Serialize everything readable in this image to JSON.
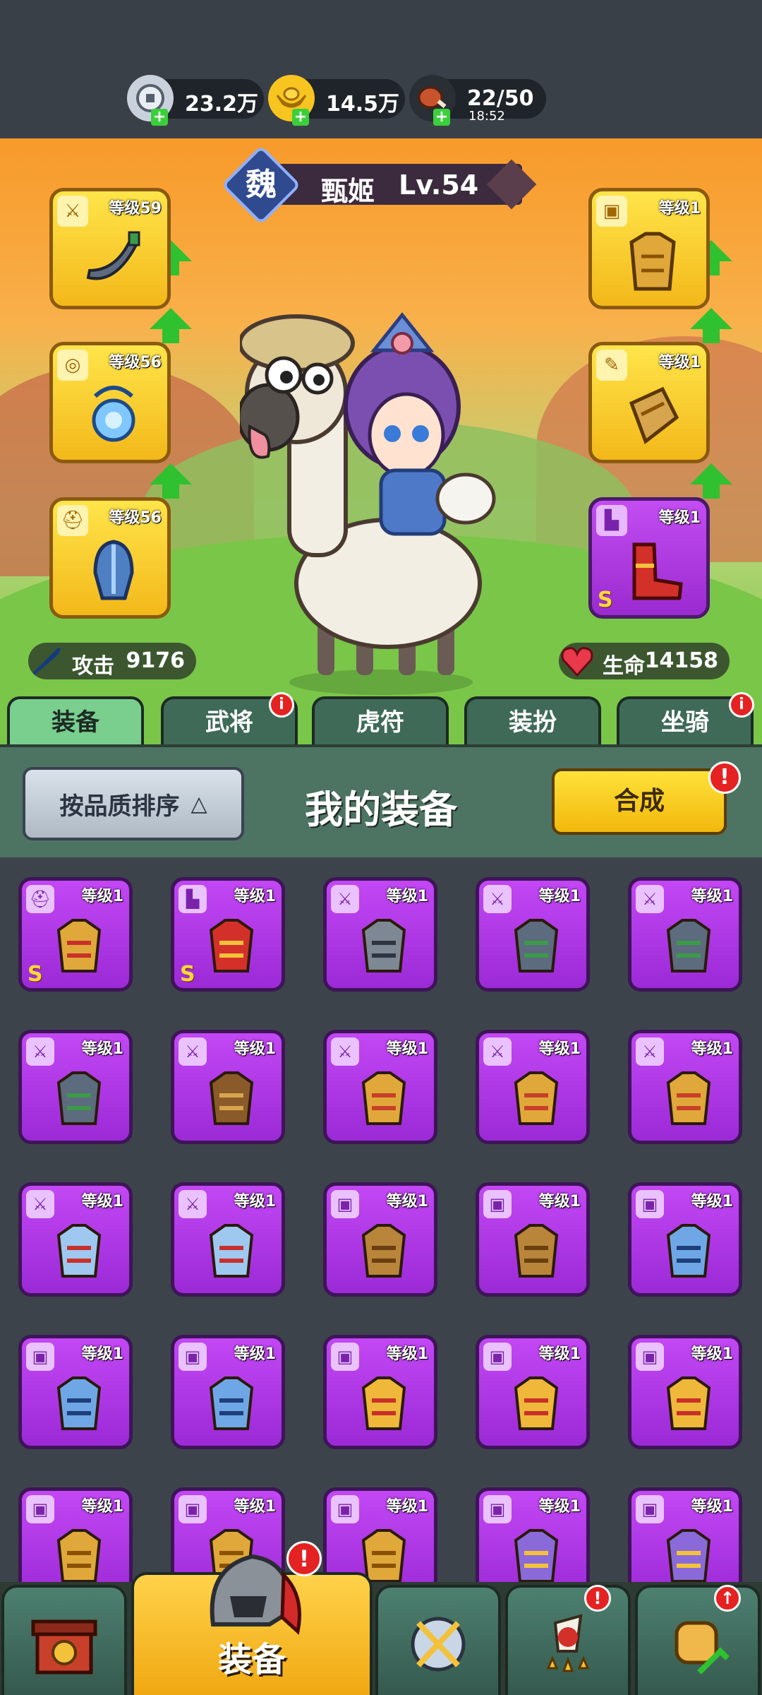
{
  "resources": [
    {
      "name": "silver-coin",
      "value": "23.2万",
      "sub": ""
    },
    {
      "name": "gold-ingot",
      "value": "14.5万",
      "sub": ""
    },
    {
      "name": "meat-stamina",
      "value": "22/50",
      "sub": "18:52"
    }
  ],
  "hero": {
    "kingdom": "魏",
    "name": "甄姬",
    "level": "Lv.54"
  },
  "equipped": {
    "left": [
      {
        "badge": "sword-icon",
        "level": "等级59",
        "color": "gold",
        "item": "curved-dagger"
      },
      {
        "badge": "medal-icon",
        "level": "等级56",
        "color": "gold",
        "item": "blue-amulet"
      },
      {
        "badge": "helmet-icon",
        "level": "等级56",
        "color": "gold",
        "item": "blue-helmet"
      }
    ],
    "right": [
      {
        "badge": "armor-icon",
        "level": "等级1",
        "color": "gold",
        "item": "gold-armor"
      },
      {
        "badge": "scroll-icon",
        "level": "等级1",
        "color": "gold",
        "item": "gold-tome"
      },
      {
        "badge": "boot-icon",
        "level": "等级1",
        "color": "purple",
        "item": "red-boots",
        "grade": "S"
      }
    ]
  },
  "stats": {
    "attack_label": "攻击",
    "attack_value": "9176",
    "hp_label": "生命",
    "hp_value": "14158"
  },
  "tabs": [
    {
      "label": "装备",
      "active": true,
      "dot": false
    },
    {
      "label": "武将",
      "active": false,
      "dot": true
    },
    {
      "label": "虎符",
      "active": false,
      "dot": false
    },
    {
      "label": "装扮",
      "active": false,
      "dot": false
    },
    {
      "label": "坐骑",
      "active": false,
      "dot": true
    }
  ],
  "panel": {
    "sort_label": "按品质排序",
    "title": "我的装备",
    "merge_label": "合成",
    "merge_dot": "!"
  },
  "inventory": [
    {
      "badge": "helmet-icon",
      "level": "等级1",
      "item": "helmet-gold-red",
      "grade": "S"
    },
    {
      "badge": "boot-icon",
      "level": "等级1",
      "item": "red-boots",
      "grade": "S"
    },
    {
      "badge": "sword-icon",
      "level": "等级1",
      "item": "shuriken",
      "grade": ""
    },
    {
      "badge": "sword-icon",
      "level": "等级1",
      "item": "curved-dagger",
      "grade": ""
    },
    {
      "badge": "sword-icon",
      "level": "等级1",
      "item": "curved-dagger",
      "grade": ""
    },
    {
      "badge": "sword-icon",
      "level": "等级1",
      "item": "curved-dagger",
      "grade": ""
    },
    {
      "badge": "sword-icon",
      "level": "等级1",
      "item": "crossbow",
      "grade": ""
    },
    {
      "badge": "sword-icon",
      "level": "等级1",
      "item": "gold-pistol",
      "grade": ""
    },
    {
      "badge": "sword-icon",
      "level": "等级1",
      "item": "gold-pistol",
      "grade": ""
    },
    {
      "badge": "sword-icon",
      "level": "等级1",
      "item": "gold-pistol",
      "grade": ""
    },
    {
      "badge": "sword-icon",
      "level": "等级1",
      "item": "red-glaive",
      "grade": ""
    },
    {
      "badge": "sword-icon",
      "level": "等级1",
      "item": "red-glaive",
      "grade": ""
    },
    {
      "badge": "armor-icon",
      "level": "等级1",
      "item": "bronze-armor",
      "grade": ""
    },
    {
      "badge": "armor-icon",
      "level": "等级1",
      "item": "bronze-armor",
      "grade": ""
    },
    {
      "badge": "armor-icon",
      "level": "等级1",
      "item": "blue-armor",
      "grade": ""
    },
    {
      "badge": "armor-icon",
      "level": "等级1",
      "item": "blue-armor",
      "grade": ""
    },
    {
      "badge": "armor-icon",
      "level": "等级1",
      "item": "blue-armor",
      "grade": ""
    },
    {
      "badge": "armor-icon",
      "level": "等级1",
      "item": "gold-red-armor",
      "grade": ""
    },
    {
      "badge": "armor-icon",
      "level": "等级1",
      "item": "gold-red-armor",
      "grade": ""
    },
    {
      "badge": "armor-icon",
      "level": "等级1",
      "item": "gold-red-armor",
      "grade": ""
    },
    {
      "badge": "armor-icon",
      "level": "等级1",
      "item": "gold-armor",
      "grade": ""
    },
    {
      "badge": "armor-icon",
      "level": "等级1",
      "item": "gold-armor",
      "grade": ""
    },
    {
      "badge": "armor-icon",
      "level": "等级1",
      "item": "gold-armor",
      "grade": ""
    },
    {
      "badge": "armor-icon",
      "level": "等级1",
      "item": "purple-gold-armor",
      "grade": ""
    },
    {
      "badge": "armor-icon",
      "level": "等级1",
      "item": "purple-gold-armor",
      "grade": ""
    }
  ],
  "bottom_nav": [
    {
      "name": "city-gate",
      "label": "",
      "active": false,
      "dot": ""
    },
    {
      "name": "equipment-helmet",
      "label": "装备",
      "active": true,
      "dot": "!"
    },
    {
      "name": "sword-shield",
      "label": "",
      "active": false,
      "dot": ""
    },
    {
      "name": "hero-stars",
      "label": "",
      "active": false,
      "dot": "!"
    },
    {
      "name": "fist-upgrade",
      "label": "",
      "active": false,
      "dot": "↑"
    }
  ],
  "colors": {
    "gold_slot": "#f8d23a",
    "purple_slot": "#b23ae8",
    "tab_active": "#7acf8f",
    "panel": "#4d7363",
    "red_dot": "#e52222"
  }
}
